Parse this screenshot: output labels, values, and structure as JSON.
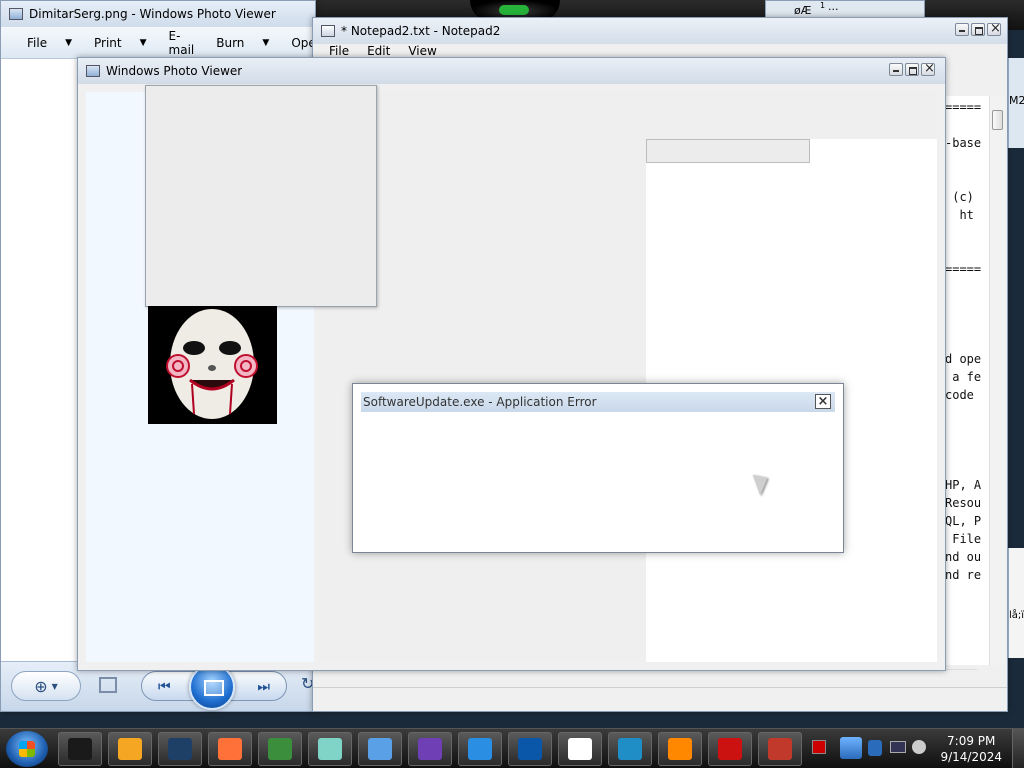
{
  "photo_viewer_back": {
    "title": "DimitarSerg.png - Windows Photo Viewer",
    "menu": [
      {
        "label": "File",
        "caret": "▼"
      },
      {
        "label": "Print",
        "caret": "▼"
      },
      {
        "label": "E-mail",
        "caret": ""
      },
      {
        "label": "Burn",
        "caret": "▼"
      },
      {
        "label": "Open",
        "caret": ""
      }
    ],
    "controls": {
      "zoom_icon": "zoom-icon",
      "prev_icon": "previous-icon",
      "slideshow_icon": "slideshow-icon",
      "next_icon": "next-icon",
      "rotate_icon": "rotate-icon"
    }
  },
  "notepad": {
    "title": "* Notepad2.txt - Notepad2",
    "menu": [
      "File",
      "Edit",
      "View"
    ],
    "lines": [
      "=====",
      "",
      "-base",
      "",
      "",
      " (c)",
      "  ht",
      "",
      "",
      "=====",
      "",
      "",
      "",
      "",
      "d ope",
      " a fe",
      "code",
      "",
      "",
      "",
      "",
      "HP, A",
      "Resou",
      "QL, P",
      " File",
      "nd ou",
      "nd re"
    ]
  },
  "photo_viewer_front": {
    "title": "Windows Photo Viewer"
  },
  "error_dialog": {
    "title": "SoftwareUpdate.exe - Application Error",
    "close_label": "×"
  },
  "right_edge": {
    "label_top": "M2",
    "label_bottom": "lå;ï¢"
  },
  "background_window": {
    "title_fragment": "øÆ",
    "title_superscript": "1"
  },
  "taskbar": {
    "apps": [
      {
        "name": "cmd-app-icon",
        "color": "#1a1a1a"
      },
      {
        "name": "media-app-icon",
        "color": "#f5a623"
      },
      {
        "name": "globe-app-icon",
        "color": "#1e3f66"
      },
      {
        "name": "firefox-icon",
        "color": "#ff7139"
      },
      {
        "name": "paint-app-icon",
        "color": "#3b8e3b"
      },
      {
        "name": "sticky-app-icon",
        "color": "#7fd3c7"
      },
      {
        "name": "photo-viewer-app-icon",
        "color": "#5aa0e6"
      },
      {
        "name": "visual-studio-icon",
        "color": "#6e3fb5"
      },
      {
        "name": "internet-explorer-icon",
        "color": "#2a8ee3"
      },
      {
        "name": "tablet-app-icon",
        "color": "#0a56a8"
      },
      {
        "name": "7zip-icon",
        "color": "#ffffff"
      },
      {
        "name": "monitor-app-icon",
        "color": "#1f8ec7"
      },
      {
        "name": "vlc-icon",
        "color": "#ff8800"
      },
      {
        "name": "red-app-icon",
        "color": "#cc1111"
      },
      {
        "name": "shapes-app-icon",
        "color": "#c0392b"
      }
    ],
    "time": "7:09 PM",
    "date": "9/14/2024"
  }
}
